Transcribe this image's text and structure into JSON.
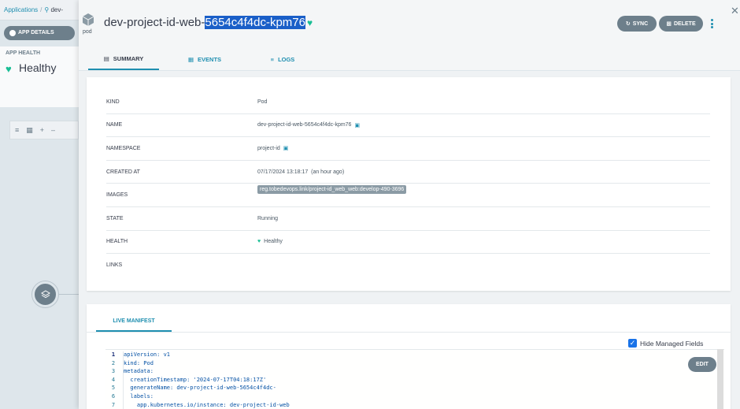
{
  "background": {
    "breadcrumb_root": "Applications",
    "breadcrumb_sep": "/",
    "breadcrumb_current": "dev-",
    "app_details_label": "APP DETAILS",
    "app_health_label": "APP HEALTH",
    "app_health_value": "Healthy"
  },
  "header": {
    "kind": "pod",
    "title_prefix": "dev-project-id-web-",
    "title_highlight": "5654c4f4dc-kpm76",
    "sync_label": "SYNC",
    "delete_label": "DELETE"
  },
  "tabs": [
    {
      "label": "SUMMARY",
      "active": true
    },
    {
      "label": "EVENTS",
      "active": false
    },
    {
      "label": "LOGS",
      "active": false
    }
  ],
  "summary": {
    "rows": [
      {
        "key": "KIND",
        "value": "Pod"
      },
      {
        "key": "NAME",
        "value": "dev-project-id-web-5654c4f4dc-kpm76"
      },
      {
        "key": "NAMESPACE",
        "value": "project-id"
      },
      {
        "key": "CREATED AT",
        "value": "07/17/2024 13:18:17  (an hour ago)"
      },
      {
        "key": "IMAGES",
        "value": "reg.tobedevops.link/project-id_web_web:develop-490-3696"
      },
      {
        "key": "STATE",
        "value": "Running"
      },
      {
        "key": "HEALTH",
        "value": "Healthy"
      },
      {
        "key": "LINKS",
        "value": ""
      }
    ]
  },
  "manifest": {
    "tab_label": "LIVE MANIFEST",
    "hide_managed_fields_label": "Hide Managed Fields",
    "hide_managed_fields_checked": true,
    "edit_label": "EDIT",
    "line_numbers": [
      "1",
      "2",
      "3",
      "4",
      "5",
      "6",
      "7"
    ],
    "lines": [
      "apiVersion: v1",
      "kind: Pod",
      "metadata:",
      "  creationTimestamp: '2024-07-17T04:18:17Z'",
      "  generateName: dev-project-id-web-5654c4f4dc-",
      "  labels:",
      "    app.kubernetes.io/instance: dev-project-id-web"
    ]
  },
  "colors": {
    "accent": "#1f8fb0",
    "healthy": "#18be94",
    "button": "#6d7f8b",
    "selection": "#1a5fc8"
  }
}
